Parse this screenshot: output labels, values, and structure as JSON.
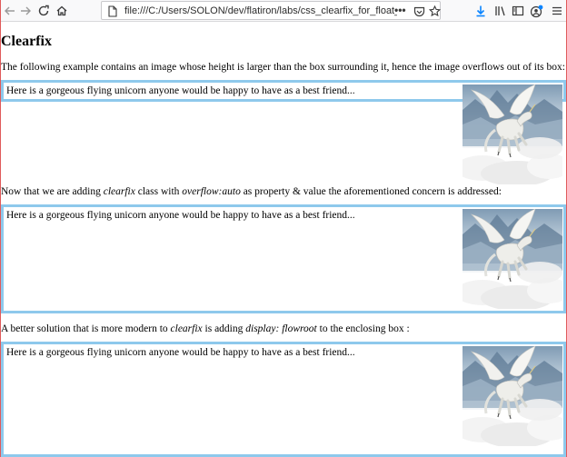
{
  "browser": {
    "url": "file:///C:/Users/SOLON/dev/flatiron/labs/css_clearfix_for_float_demo/index.htm",
    "more_label": "•••"
  },
  "page": {
    "title": "Clearfix",
    "intro": "The following example contains an image whose height is larger than the box surrounding it, hence the image overflows out of its box:",
    "box_text": "Here is a gorgeous flying unicorn anyone would be happy to have as a best friend...",
    "para2": {
      "a": "Now that we are adding ",
      "b": "clearfix",
      "c": " class with ",
      "d": "overflow:auto",
      "e": " as property & value the aforementioned concern is addressed:"
    },
    "para3": {
      "a": "A better solution that is more modern to ",
      "b": "clearfix",
      "c": " is adding ",
      "d": "display: flowroot",
      "e": " to the enclosing box :"
    }
  },
  "colors": {
    "box_border": "#8ec9ec",
    "window_border": "#e05a5a",
    "download_accent": "#0a84ff"
  }
}
